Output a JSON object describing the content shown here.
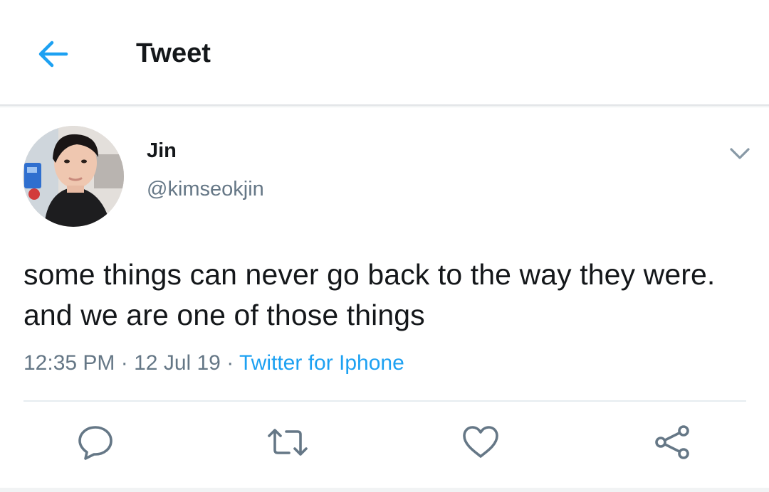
{
  "header": {
    "title": "Tweet",
    "back_icon": "arrow-left-icon"
  },
  "tweet": {
    "display_name": "Jin",
    "handle": "@kimseokjin",
    "text": "some things can never go back to the way they were. and we are one of those things",
    "time": "12:35 PM",
    "date": "12 Jul 19",
    "separator": "·",
    "source": "Twitter for Iphone"
  },
  "actions": [
    {
      "icon": "reply-icon"
    },
    {
      "icon": "retweet-icon"
    },
    {
      "icon": "like-icon"
    },
    {
      "icon": "share-icon"
    }
  ],
  "colors": {
    "accent": "#1da1f2",
    "text": "#14171a",
    "secondary": "#657786",
    "divider": "#e6ecf0"
  }
}
